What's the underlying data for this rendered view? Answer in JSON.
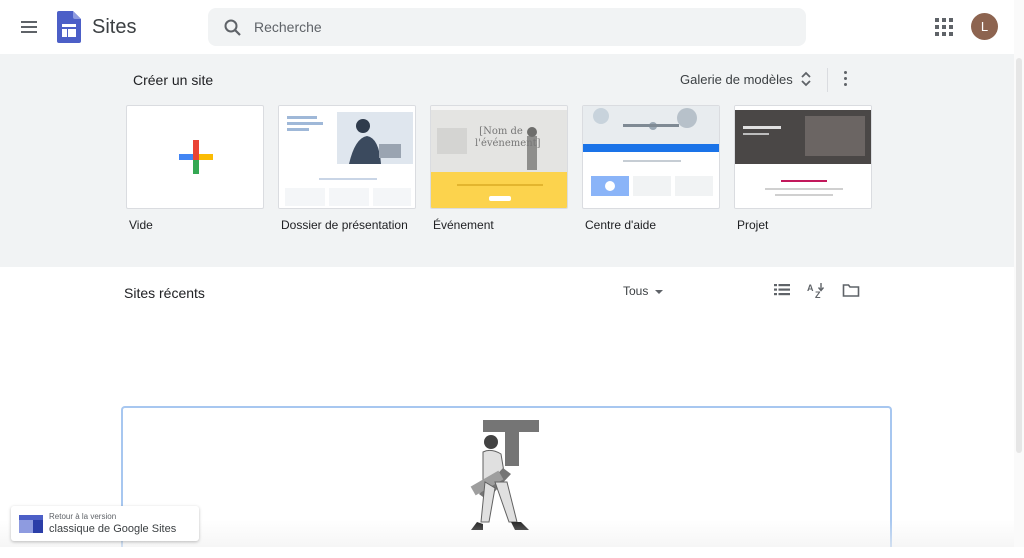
{
  "header": {
    "app_title": "Sites",
    "search_placeholder": "Recherche",
    "avatar_initial": "L"
  },
  "gallery": {
    "title": "Créer un site",
    "gallery_link": "Galerie de modèles",
    "templates": [
      {
        "label": "Vide",
        "thumb": "blank"
      },
      {
        "label": "Dossier de présentation",
        "thumb": "portfolio"
      },
      {
        "label": "Événement",
        "thumb": "event"
      },
      {
        "label": "Centre d'aide",
        "thumb": "help"
      },
      {
        "label": "Projet",
        "thumb": "project"
      }
    ],
    "thumb_text": {
      "event_heading": "[Nom de l'événement]"
    }
  },
  "recent": {
    "title": "Sites récents",
    "filter_value": "Tous"
  },
  "toast": {
    "line1": "Retour à la version",
    "line2": "classique de Google Sites"
  },
  "colors": {
    "accent_blue": "#1a73e8",
    "sites_purple": "#4c5fc7",
    "gallery_bg": "#f1f3f4",
    "avatar": "#8d6450",
    "event_yellow": "#fcd34d"
  }
}
